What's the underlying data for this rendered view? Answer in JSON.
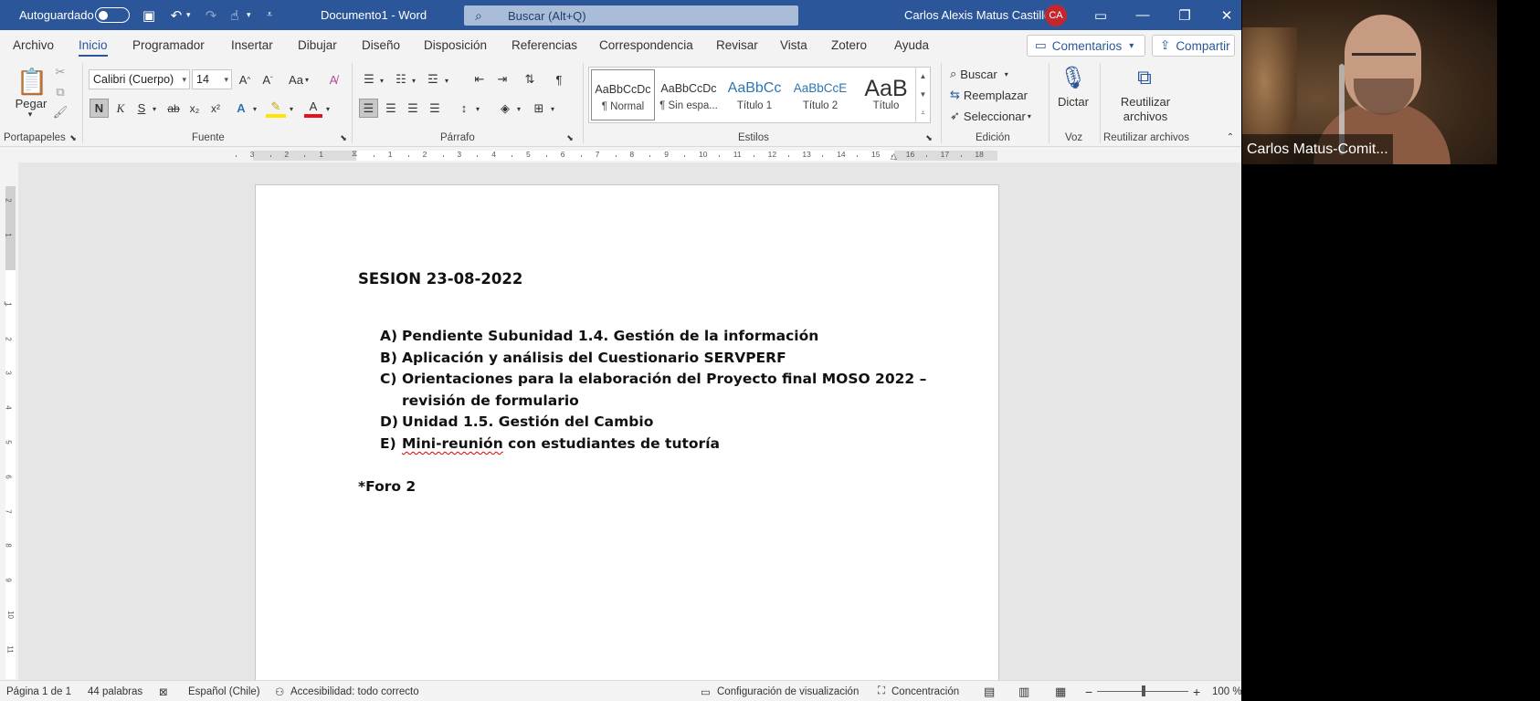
{
  "titlebar": {
    "autosave_label": "Autoguardado",
    "doc_title": "Documento1  -  Word",
    "search_placeholder": "Buscar (Alt+Q)",
    "user_name": "Carlos Alexis Matus Castillo",
    "user_initials": "CA"
  },
  "menu": {
    "tabs": [
      "Archivo",
      "Inicio",
      "Programador",
      "Insertar",
      "Dibujar",
      "Diseño",
      "Disposición",
      "Referencias",
      "Correspondencia",
      "Revisar",
      "Vista",
      "Zotero",
      "Ayuda"
    ],
    "active_tab": "Inicio",
    "comments_label": "Comentarios",
    "share_label": "Compartir"
  },
  "ribbon": {
    "clipboard": {
      "paste_label": "Pegar",
      "group_label": "Portapapeles"
    },
    "font": {
      "font_name": "Calibri (Cuerpo)",
      "font_size": "14",
      "case_label": "Aa",
      "bold": "N",
      "italic": "K",
      "underline": "S",
      "strike": "ab",
      "group_label": "Fuente"
    },
    "paragraph": {
      "group_label": "Párrafo"
    },
    "styles": {
      "items": [
        {
          "sample": "AaBbCcDc",
          "name": "¶ Normal"
        },
        {
          "sample": "AaBbCcDc",
          "name": "¶ Sin espa..."
        },
        {
          "sample": "AaBbCc",
          "name": "Título 1"
        },
        {
          "sample": "AaBbCcE",
          "name": "Título 2"
        },
        {
          "sample": "AaB",
          "name": "Título"
        }
      ],
      "group_label": "Estilos"
    },
    "editing": {
      "find": "Buscar",
      "replace": "Reemplazar",
      "select": "Seleccionar",
      "group_label": "Edición"
    },
    "voice": {
      "dictate": "Dictar",
      "group_label": "Voz"
    },
    "reuse": {
      "label_line1": "Reutilizar",
      "label_line2": "archivos",
      "group_label": "Reutilizar archivos"
    }
  },
  "ruler": {
    "labels": [
      "3",
      "2",
      "1",
      "1",
      "2",
      "3",
      "4",
      "5",
      "6",
      "7",
      "8",
      "9",
      "10",
      "11",
      "12",
      "13",
      "14",
      "15",
      "16",
      "17",
      "18"
    ],
    "v_labels": [
      "2",
      "1",
      "1",
      "2",
      "3",
      "4",
      "5",
      "6",
      "7",
      "8",
      "9",
      "10",
      "11"
    ]
  },
  "document": {
    "title": "SESION 23-08-2022",
    "items": [
      {
        "marker": "A)",
        "text": "Pendiente Subunidad 1.4. Gestión de la información"
      },
      {
        "marker": "B)",
        "text": "Aplicación y análisis del Cuestionario SERVPERF"
      },
      {
        "marker": "C)",
        "text": "Orientaciones para la elaboración del Proyecto final MOSO 2022 –",
        "text2": "revisión de formulario"
      },
      {
        "marker": "D)",
        "text": "Unidad 1.5. Gestión del Cambio"
      },
      {
        "marker": "E)",
        "text_squiggle": "Mini-reunión",
        "text": " con estudiantes de tutoría"
      }
    ],
    "footer_note": "*Foro 2"
  },
  "statusbar": {
    "page": "Página 1 de 1",
    "words": "44 palabras",
    "language": "Español (Chile)",
    "accessibility": "Accesibilidad: todo correcto",
    "display_settings": "Configuración de visualización",
    "focus": "Concentración",
    "zoom": "100 %"
  },
  "video": {
    "participant_name": "Carlos Matus-Comit..."
  },
  "colors": {
    "word_blue": "#2b579a",
    "avatar_red": "#c4262e"
  }
}
